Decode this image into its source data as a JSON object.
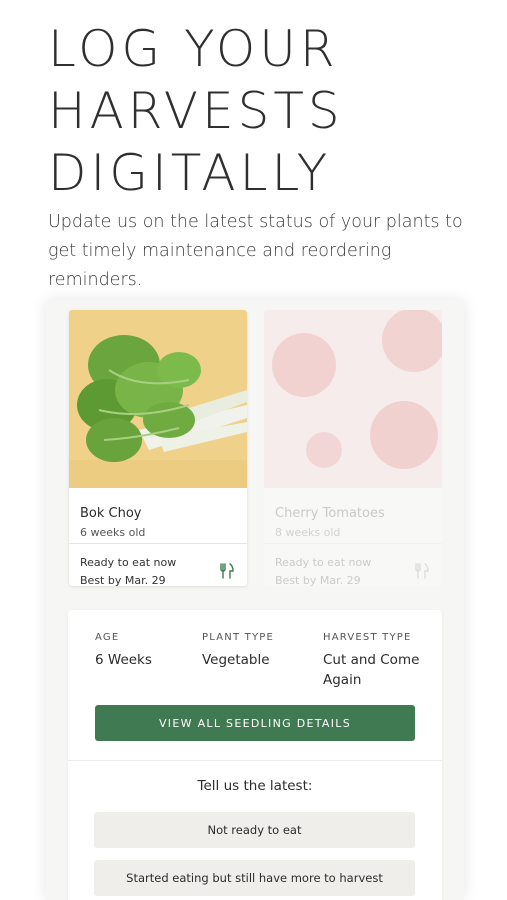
{
  "hero": {
    "title_lines": [
      "LOG YOUR",
      "HARVESTS",
      "DIGITALLY"
    ],
    "subtitle": "Update us on the latest status of your plants to get timely maintenance and reordering reminders."
  },
  "cards": [
    {
      "name": "Bok Choy",
      "age": "6 weeks old",
      "status_line1": "Ready to eat now",
      "status_line2": "Best by Mar. 29",
      "icon": "fork-knife-icon",
      "image_bg": "#efd18a"
    },
    {
      "name": "Cherry Tomatoes",
      "age": "8 weeks old",
      "status_line1": "Ready to eat now",
      "status_line2": "Best by Mar. 29",
      "icon": "fork-knife-icon",
      "image_bg": "#f4b3b3"
    }
  ],
  "details": {
    "age_label": "AGE",
    "age_value": "6 Weeks",
    "plant_type_label": "PLANT TYPE",
    "plant_type_value": "Vegetable",
    "harvest_type_label": "HARVEST TYPE",
    "harvest_type_value": "Cut and Come Again",
    "view_button": "VIEW ALL SEEDLING DETAILS",
    "prompt": "Tell us the latest:",
    "options": [
      "Not ready to eat",
      "Started eating but still have more to harvest"
    ]
  },
  "colors": {
    "accent_green": "#3f7a52",
    "panel_bg": "#f6f6f4",
    "option_bg": "#efeeeb"
  }
}
